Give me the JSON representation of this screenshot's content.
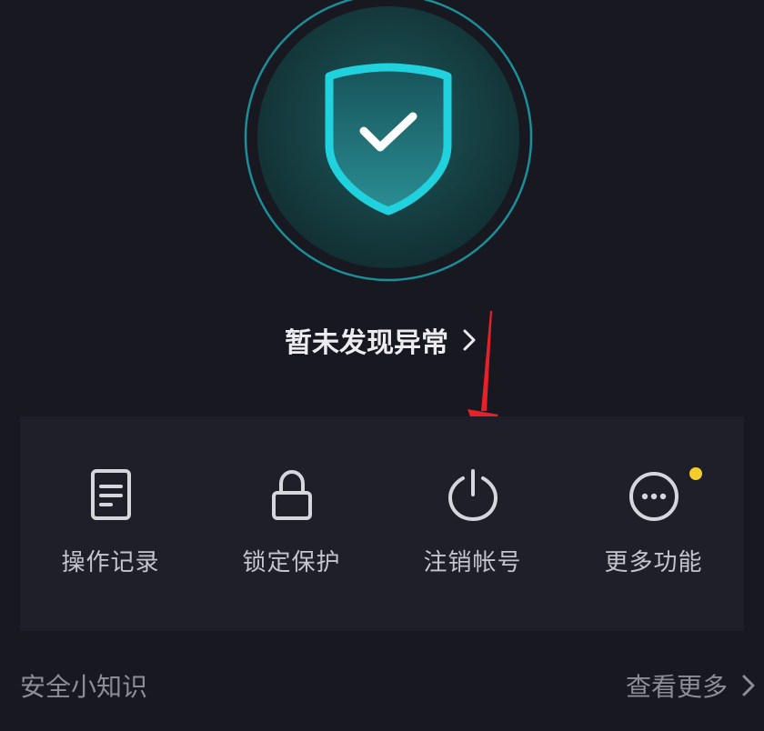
{
  "security_status": {
    "text": "暂未发现异常",
    "shield_icon": "shield-check-icon"
  },
  "actions": [
    {
      "label": "操作记录",
      "icon": "document-icon"
    },
    {
      "label": "锁定保护",
      "icon": "lock-icon"
    },
    {
      "label": "注销帐号",
      "icon": "power-icon"
    },
    {
      "label": "更多功能",
      "icon": "more-icon",
      "badge": true
    }
  ],
  "tips": {
    "title": "安全小知识",
    "more_label": "查看更多"
  },
  "colors": {
    "background": "#171820",
    "panel": "#1e1f28",
    "accent_teal": "#1dc4d0",
    "annotation_arrow": "#e8202a",
    "badge": "#f4cd2d"
  }
}
